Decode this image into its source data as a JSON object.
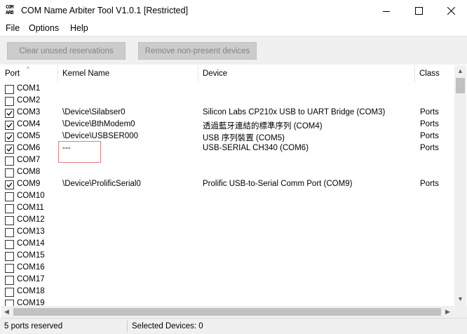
{
  "window": {
    "icon_text_top": "COM",
    "icon_text_bottom": "ARB",
    "title": "COM Name Arbiter Tool V1.0.1  [Restricted]"
  },
  "menu": [
    "File",
    "Options",
    "Help"
  ],
  "toolbar": {
    "clear_label": "Clear unused reservations",
    "remove_label": "Remove non-present devices"
  },
  "columns": {
    "port": "Port",
    "kernel": "Kernel Name",
    "device": "Device",
    "class": "Class"
  },
  "rows": [
    {
      "port": "COM1",
      "checked": false,
      "kernel": "",
      "device": "",
      "class": ""
    },
    {
      "port": "COM2",
      "checked": false,
      "kernel": "",
      "device": "",
      "class": ""
    },
    {
      "port": "COM3",
      "checked": true,
      "kernel": "\\Device\\Silabser0",
      "device": "Silicon Labs CP210x USB to UART Bridge (COM3)",
      "class": "Ports"
    },
    {
      "port": "COM4",
      "checked": true,
      "kernel": "\\Device\\BthModem0",
      "device": "透過藍牙連結的標準序列 (COM4)",
      "class": "Ports"
    },
    {
      "port": "COM5",
      "checked": true,
      "kernel": "\\Device\\USBSER000",
      "device": "USB 序列裝置 (COM5)",
      "class": "Ports"
    },
    {
      "port": "COM6",
      "checked": true,
      "kernel": "---",
      "device": "USB-SERIAL CH340 (COM6)",
      "class": "Ports"
    },
    {
      "port": "COM7",
      "checked": false,
      "kernel": "",
      "device": "",
      "class": ""
    },
    {
      "port": "COM8",
      "checked": false,
      "kernel": "",
      "device": "",
      "class": ""
    },
    {
      "port": "COM9",
      "checked": true,
      "kernel": "\\Device\\ProlificSerial0",
      "device": "Prolific USB-to-Serial Comm Port (COM9)",
      "class": "Ports"
    },
    {
      "port": "COM10",
      "checked": false,
      "kernel": "",
      "device": "",
      "class": ""
    },
    {
      "port": "COM11",
      "checked": false,
      "kernel": "",
      "device": "",
      "class": ""
    },
    {
      "port": "COM12",
      "checked": false,
      "kernel": "",
      "device": "",
      "class": ""
    },
    {
      "port": "COM13",
      "checked": false,
      "kernel": "",
      "device": "",
      "class": ""
    },
    {
      "port": "COM14",
      "checked": false,
      "kernel": "",
      "device": "",
      "class": ""
    },
    {
      "port": "COM15",
      "checked": false,
      "kernel": "",
      "device": "",
      "class": ""
    },
    {
      "port": "COM16",
      "checked": false,
      "kernel": "",
      "device": "",
      "class": ""
    },
    {
      "port": "COM17",
      "checked": false,
      "kernel": "",
      "device": "",
      "class": ""
    },
    {
      "port": "COM18",
      "checked": false,
      "kernel": "",
      "device": "",
      "class": ""
    },
    {
      "port": "COM19",
      "checked": false,
      "kernel": "",
      "device": "",
      "class": ""
    }
  ],
  "status": {
    "reserved": "5 ports reserved",
    "selected": "Selected Devices: 0"
  },
  "colors": {
    "highlight_border": "#e08080",
    "button_disabled_bg": "#cccccc",
    "button_disabled_text": "#838383"
  }
}
